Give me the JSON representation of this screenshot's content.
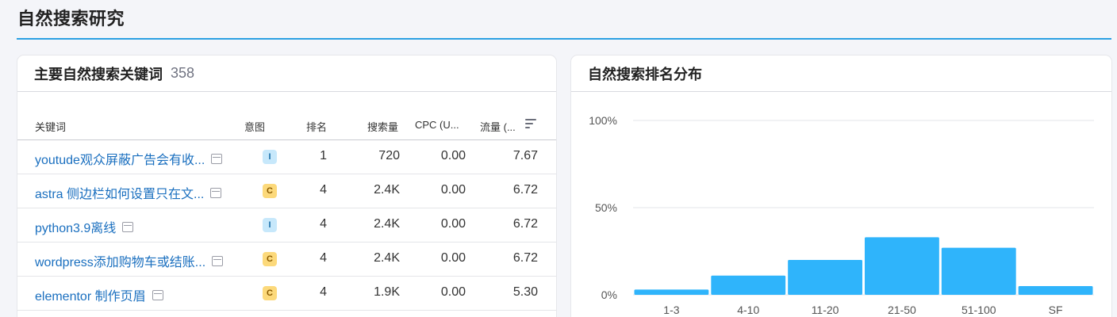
{
  "page_title": "自然搜索研究",
  "keywords_card": {
    "title": "主要自然搜索关键词",
    "count": "358",
    "columns": {
      "keyword": "关键词",
      "intent": "意图",
      "position": "排名",
      "volume": "搜索量",
      "cpc": "CPC (U...",
      "traffic": "流量 (..."
    },
    "rows": [
      {
        "keyword": "youtude观众屏蔽广告会有收...",
        "intent": "I",
        "position": "1",
        "volume": "720",
        "cpc": "0.00",
        "traffic": "7.67"
      },
      {
        "keyword": "astra 侧边栏如何设置只在文...",
        "intent": "C",
        "position": "4",
        "volume": "2.4K",
        "cpc": "0.00",
        "traffic": "6.72"
      },
      {
        "keyword": "python3.9离线",
        "intent": "I",
        "position": "4",
        "volume": "2.4K",
        "cpc": "0.00",
        "traffic": "6.72"
      },
      {
        "keyword": "wordpress添加购物车或结账...",
        "intent": "C",
        "position": "4",
        "volume": "2.4K",
        "cpc": "0.00",
        "traffic": "6.72"
      },
      {
        "keyword": "elementor 制作页眉",
        "intent": "C",
        "position": "4",
        "volume": "1.9K",
        "cpc": "0.00",
        "traffic": "5.30"
      }
    ]
  },
  "distribution_card": {
    "title": "自然搜索排名分布"
  },
  "chart_data": {
    "type": "bar",
    "categories": [
      "1-3",
      "4-10",
      "11-20",
      "21-50",
      "51-100",
      "SF"
    ],
    "values": [
      3,
      11,
      20,
      33,
      27,
      5
    ],
    "ylim": [
      0,
      100
    ],
    "yticks": [
      "100%",
      "50%",
      "0%"
    ],
    "ytick_values": [
      100,
      50,
      0
    ],
    "grid": true,
    "bar_color": "#2fb4fb",
    "grid_color": "#e3e4e8"
  }
}
